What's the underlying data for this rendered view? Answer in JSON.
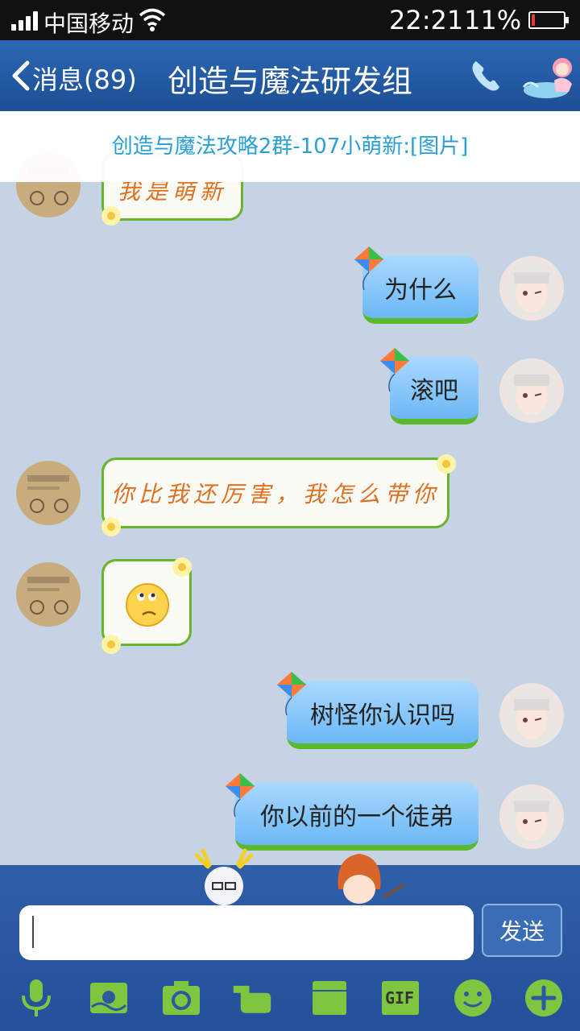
{
  "status_bar": {
    "carrier": "中国移动",
    "time": "22:21",
    "battery_pct": "11%",
    "battery_level": 0.11
  },
  "header": {
    "back_label": "消息(89)",
    "title": "创造与魔法研发组"
  },
  "pinned_message": "创造与魔法攻略2群-107小萌新:[图片]",
  "messages": [
    {
      "side": "left",
      "text": "我是萌新"
    },
    {
      "side": "right",
      "text": "为什么"
    },
    {
      "side": "right",
      "text": "滚吧"
    },
    {
      "side": "left",
      "text": "你比我还厉害，我怎么带你"
    },
    {
      "side": "left",
      "type": "emoji",
      "emoji": "thinking-face"
    },
    {
      "side": "right",
      "text": "树怪你认识吗"
    },
    {
      "side": "right",
      "text": "你以前的一个徒弟"
    }
  ],
  "input": {
    "value": "",
    "send_label": "发送"
  },
  "toolbar": {
    "items": [
      "microphone-icon",
      "image-icon",
      "camera-icon",
      "hand-icon",
      "folder-icon",
      "gif-icon",
      "smiley-icon",
      "plus-icon"
    ],
    "gif_label": "GIF"
  },
  "colors": {
    "title_bar": "#2b67b3",
    "pinned_text": "#2a9fd6",
    "chat_background": "#c5d3e4",
    "left_bubble_border": "#66b52c",
    "left_bubble_text": "#e07020",
    "right_bubble": "#8cc8fb"
  }
}
